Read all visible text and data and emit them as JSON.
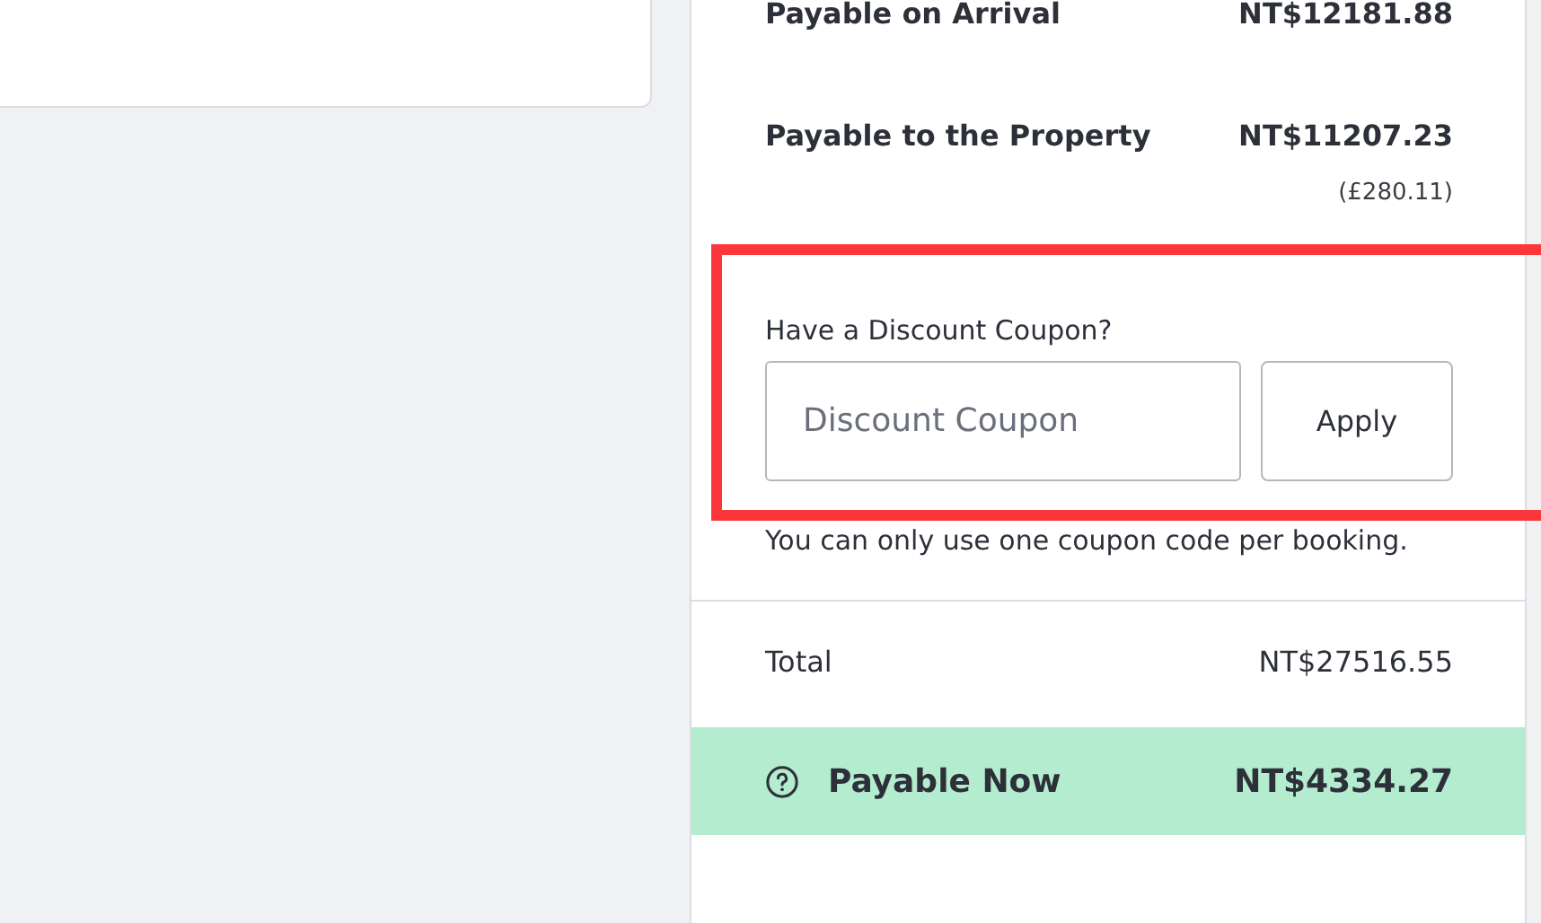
{
  "summary": {
    "lines": [
      {
        "label": "Payable on Arrival",
        "amount": "NT$12181.88"
      },
      {
        "label": "Payable to the Property",
        "amount": "NT$11207.23",
        "note": "(£280.11)"
      }
    ]
  },
  "coupon": {
    "label": "Have a Discount Coupon?",
    "placeholder": "Discount Coupon",
    "button": "Apply",
    "note": "You can only use one coupon code per booking."
  },
  "total": {
    "label": "Total",
    "amount": "NT$27516.55"
  },
  "payable_now": {
    "label": "Payable Now",
    "amount": "NT$4334.27"
  }
}
